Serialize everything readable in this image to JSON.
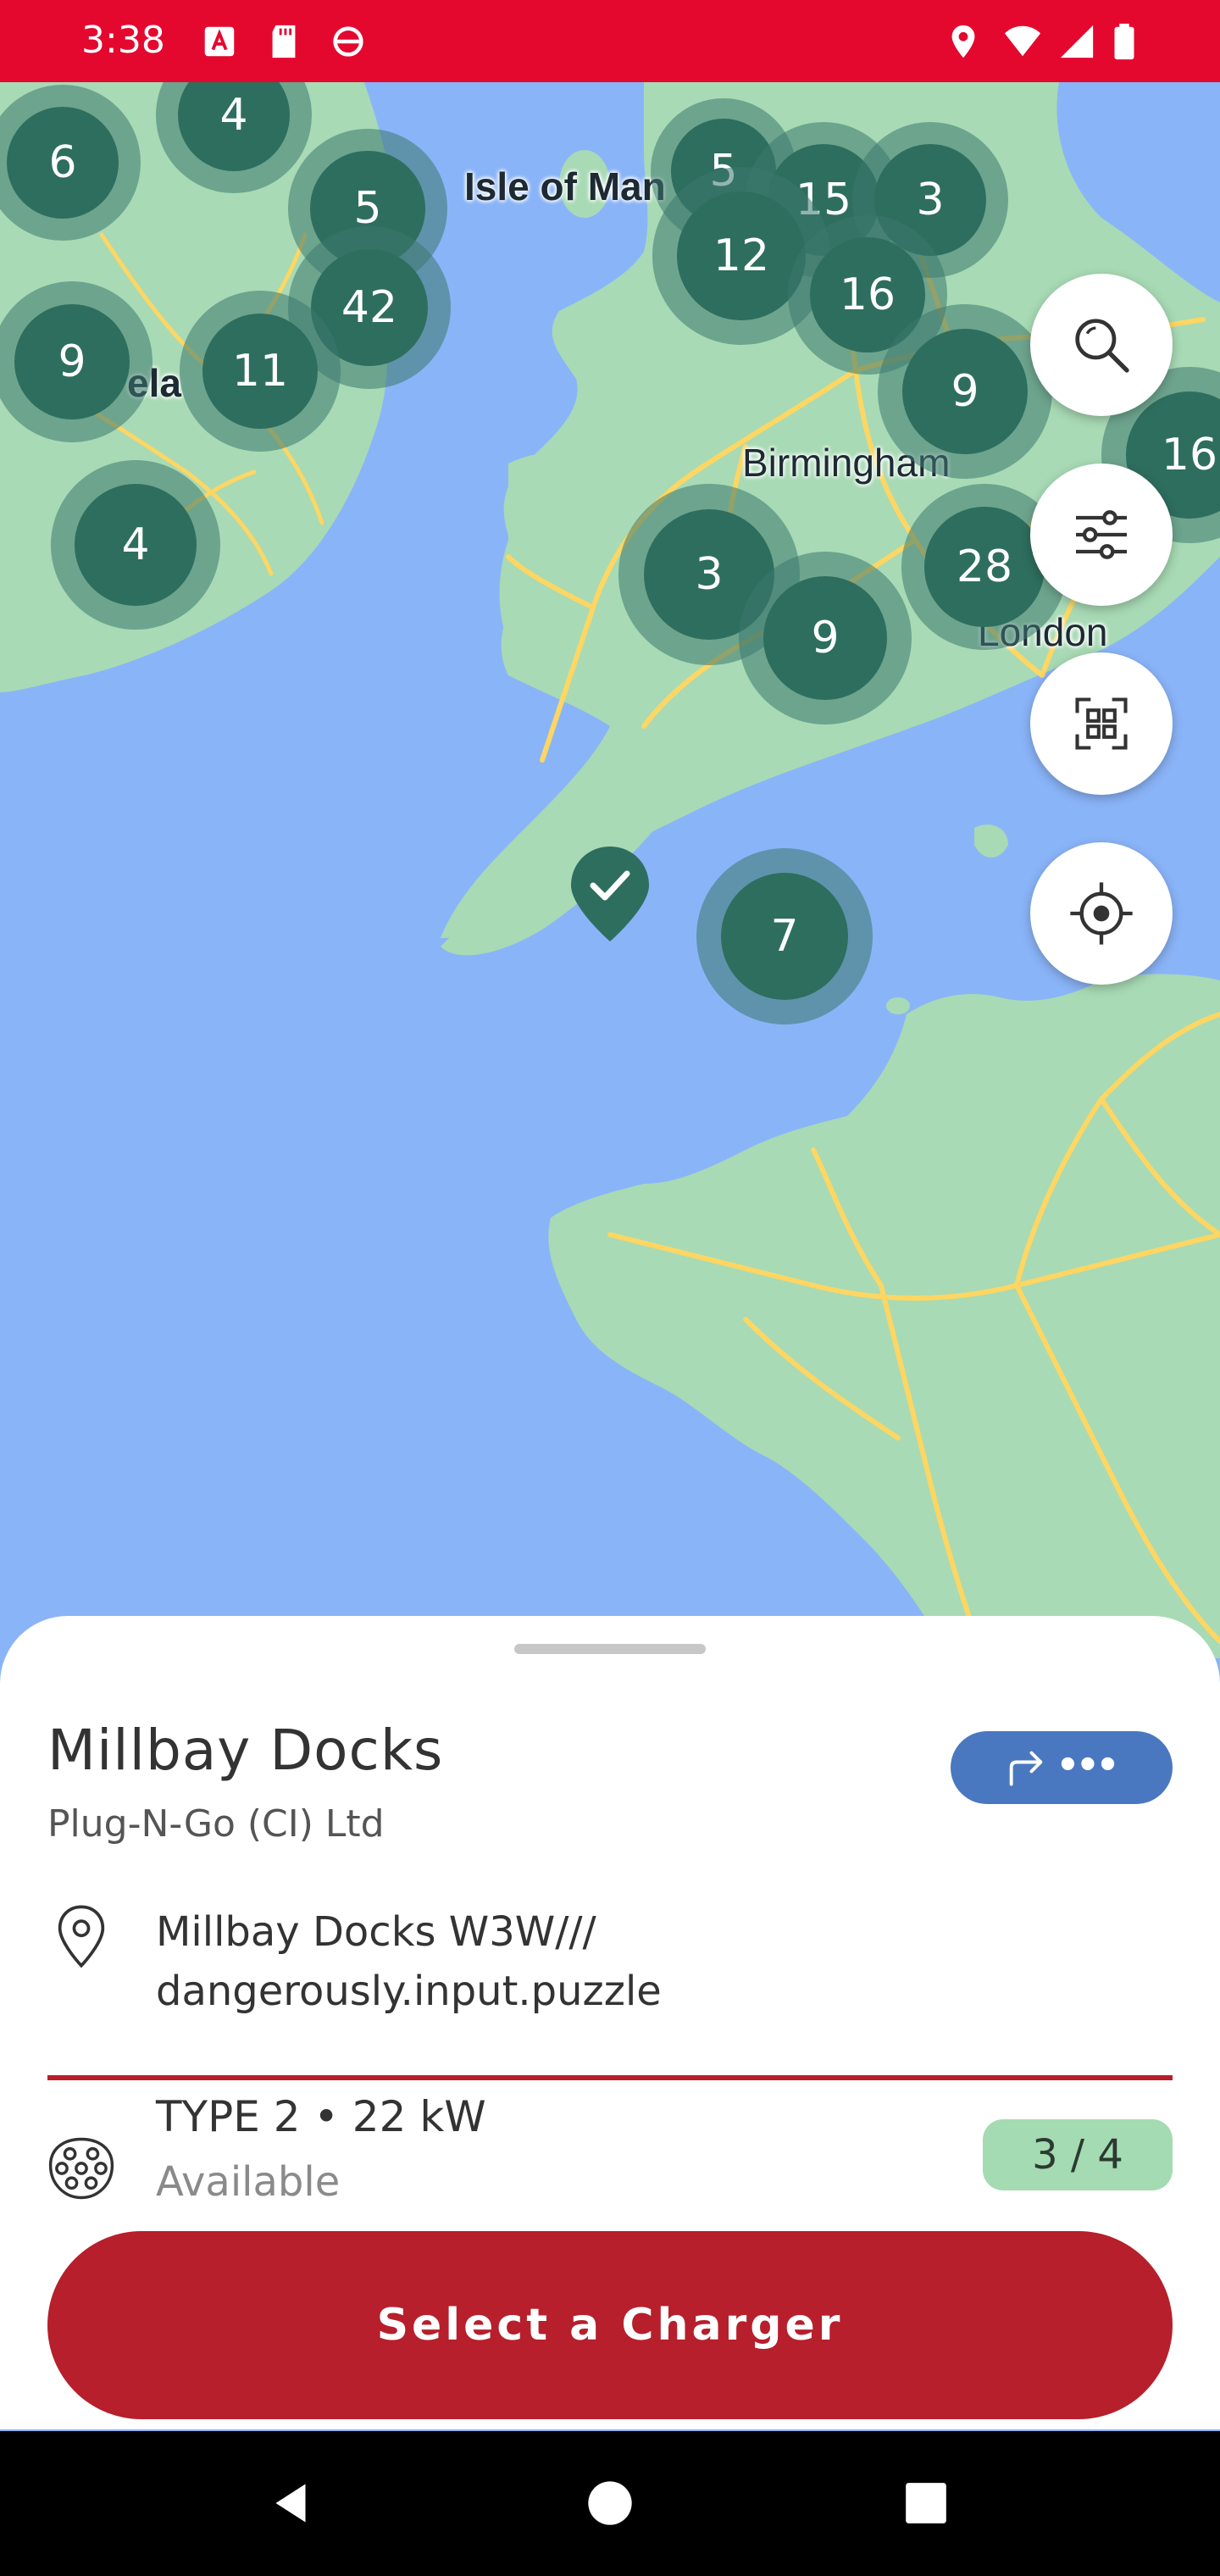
{
  "status_bar": {
    "time": "3:38",
    "icons": [
      "pdf-notification-icon",
      "sd-card-icon",
      "sync-icon",
      "location-icon",
      "wifi-icon",
      "signal-icon",
      "battery-icon"
    ]
  },
  "map": {
    "labels": {
      "isle_of_man": "Isle of Man",
      "ireland": "ela",
      "birmingham": "Birmingham",
      "london": "London"
    },
    "clusters": [
      "6",
      "4",
      "5",
      "42",
      "9",
      "11",
      "4",
      "5",
      "15",
      "3",
      "12",
      "16",
      "9",
      "16",
      "3",
      "9",
      "28",
      "7"
    ],
    "colors": {
      "water": "#8ab4f8",
      "land": "#a8dab5",
      "road": "#fdd663",
      "cluster": "#2e6e5e"
    }
  },
  "map_controls": {
    "search": "search-icon",
    "filter": "filter-icon",
    "scan": "qr-scan-icon",
    "locate": "locate-icon"
  },
  "selected_pin": {
    "icon": "checkmark-icon"
  },
  "sheet": {
    "title": "Millbay Docks",
    "operator": "Plug-N-Go (CI) Ltd",
    "directions_more": "•••",
    "address_line1": "Millbay Docks W3W///",
    "address_line2": "dangerously.input.puzzle",
    "connector": {
      "type": "TYPE 2 • 22 kW",
      "status": "Available",
      "count": "3 / 4"
    },
    "primary_button": "Select a Charger",
    "colors": {
      "primary": "#b61f2b",
      "directions": "#4a78c0",
      "available_badge": "#a4dbb2"
    }
  },
  "navbar": {
    "items": [
      "back-icon",
      "home-icon",
      "recents-icon"
    ]
  }
}
